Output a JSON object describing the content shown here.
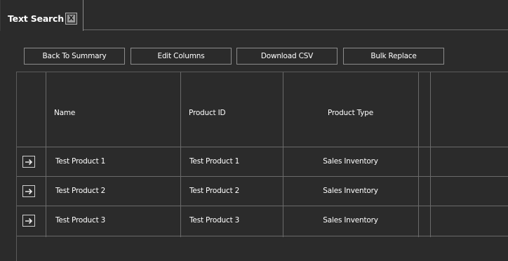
{
  "tab": {
    "title": "Text Search",
    "close_label": "X"
  },
  "toolbar": {
    "back_label": "Back To Summary",
    "edit_columns_label": "Edit Columns",
    "download_csv_label": "Download CSV",
    "bulk_replace_label": "Bulk Replace"
  },
  "table": {
    "columns": [
      "",
      "Name",
      "Product ID",
      "Product Type",
      ""
    ],
    "rows": [
      {
        "name": "Test Product 1",
        "product_id": "Test Product 1",
        "product_type": "Sales Inventory"
      },
      {
        "name": "Test Product 2",
        "product_id": "Test Product 2",
        "product_type": "Sales Inventory"
      },
      {
        "name": "Test Product 3",
        "product_id": "Test Product 3",
        "product_type": "Sales Inventory"
      }
    ],
    "row_action_icon": "arrow-right-icon"
  }
}
